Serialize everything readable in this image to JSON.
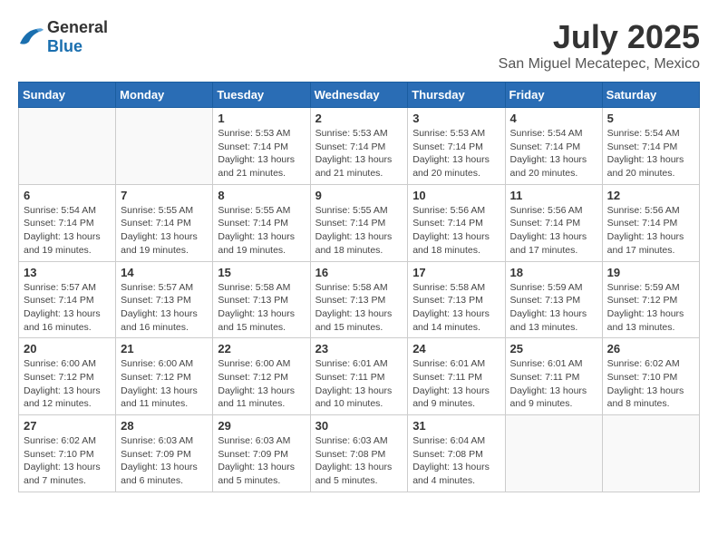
{
  "header": {
    "logo_general": "General",
    "logo_blue": "Blue",
    "month_year": "July 2025",
    "location": "San Miguel Mecatepec, Mexico"
  },
  "days_of_week": [
    "Sunday",
    "Monday",
    "Tuesday",
    "Wednesday",
    "Thursday",
    "Friday",
    "Saturday"
  ],
  "weeks": [
    [
      {
        "day": "",
        "detail": ""
      },
      {
        "day": "",
        "detail": ""
      },
      {
        "day": "1",
        "detail": "Sunrise: 5:53 AM\nSunset: 7:14 PM\nDaylight: 13 hours and 21 minutes."
      },
      {
        "day": "2",
        "detail": "Sunrise: 5:53 AM\nSunset: 7:14 PM\nDaylight: 13 hours and 21 minutes."
      },
      {
        "day": "3",
        "detail": "Sunrise: 5:53 AM\nSunset: 7:14 PM\nDaylight: 13 hours and 20 minutes."
      },
      {
        "day": "4",
        "detail": "Sunrise: 5:54 AM\nSunset: 7:14 PM\nDaylight: 13 hours and 20 minutes."
      },
      {
        "day": "5",
        "detail": "Sunrise: 5:54 AM\nSunset: 7:14 PM\nDaylight: 13 hours and 20 minutes."
      }
    ],
    [
      {
        "day": "6",
        "detail": "Sunrise: 5:54 AM\nSunset: 7:14 PM\nDaylight: 13 hours and 19 minutes."
      },
      {
        "day": "7",
        "detail": "Sunrise: 5:55 AM\nSunset: 7:14 PM\nDaylight: 13 hours and 19 minutes."
      },
      {
        "day": "8",
        "detail": "Sunrise: 5:55 AM\nSunset: 7:14 PM\nDaylight: 13 hours and 19 minutes."
      },
      {
        "day": "9",
        "detail": "Sunrise: 5:55 AM\nSunset: 7:14 PM\nDaylight: 13 hours and 18 minutes."
      },
      {
        "day": "10",
        "detail": "Sunrise: 5:56 AM\nSunset: 7:14 PM\nDaylight: 13 hours and 18 minutes."
      },
      {
        "day": "11",
        "detail": "Sunrise: 5:56 AM\nSunset: 7:14 PM\nDaylight: 13 hours and 17 minutes."
      },
      {
        "day": "12",
        "detail": "Sunrise: 5:56 AM\nSunset: 7:14 PM\nDaylight: 13 hours and 17 minutes."
      }
    ],
    [
      {
        "day": "13",
        "detail": "Sunrise: 5:57 AM\nSunset: 7:14 PM\nDaylight: 13 hours and 16 minutes."
      },
      {
        "day": "14",
        "detail": "Sunrise: 5:57 AM\nSunset: 7:13 PM\nDaylight: 13 hours and 16 minutes."
      },
      {
        "day": "15",
        "detail": "Sunrise: 5:58 AM\nSunset: 7:13 PM\nDaylight: 13 hours and 15 minutes."
      },
      {
        "day": "16",
        "detail": "Sunrise: 5:58 AM\nSunset: 7:13 PM\nDaylight: 13 hours and 15 minutes."
      },
      {
        "day": "17",
        "detail": "Sunrise: 5:58 AM\nSunset: 7:13 PM\nDaylight: 13 hours and 14 minutes."
      },
      {
        "day": "18",
        "detail": "Sunrise: 5:59 AM\nSunset: 7:13 PM\nDaylight: 13 hours and 13 minutes."
      },
      {
        "day": "19",
        "detail": "Sunrise: 5:59 AM\nSunset: 7:12 PM\nDaylight: 13 hours and 13 minutes."
      }
    ],
    [
      {
        "day": "20",
        "detail": "Sunrise: 6:00 AM\nSunset: 7:12 PM\nDaylight: 13 hours and 12 minutes."
      },
      {
        "day": "21",
        "detail": "Sunrise: 6:00 AM\nSunset: 7:12 PM\nDaylight: 13 hours and 11 minutes."
      },
      {
        "day": "22",
        "detail": "Sunrise: 6:00 AM\nSunset: 7:12 PM\nDaylight: 13 hours and 11 minutes."
      },
      {
        "day": "23",
        "detail": "Sunrise: 6:01 AM\nSunset: 7:11 PM\nDaylight: 13 hours and 10 minutes."
      },
      {
        "day": "24",
        "detail": "Sunrise: 6:01 AM\nSunset: 7:11 PM\nDaylight: 13 hours and 9 minutes."
      },
      {
        "day": "25",
        "detail": "Sunrise: 6:01 AM\nSunset: 7:11 PM\nDaylight: 13 hours and 9 minutes."
      },
      {
        "day": "26",
        "detail": "Sunrise: 6:02 AM\nSunset: 7:10 PM\nDaylight: 13 hours and 8 minutes."
      }
    ],
    [
      {
        "day": "27",
        "detail": "Sunrise: 6:02 AM\nSunset: 7:10 PM\nDaylight: 13 hours and 7 minutes."
      },
      {
        "day": "28",
        "detail": "Sunrise: 6:03 AM\nSunset: 7:09 PM\nDaylight: 13 hours and 6 minutes."
      },
      {
        "day": "29",
        "detail": "Sunrise: 6:03 AM\nSunset: 7:09 PM\nDaylight: 13 hours and 5 minutes."
      },
      {
        "day": "30",
        "detail": "Sunrise: 6:03 AM\nSunset: 7:08 PM\nDaylight: 13 hours and 5 minutes."
      },
      {
        "day": "31",
        "detail": "Sunrise: 6:04 AM\nSunset: 7:08 PM\nDaylight: 13 hours and 4 minutes."
      },
      {
        "day": "",
        "detail": ""
      },
      {
        "day": "",
        "detail": ""
      }
    ]
  ]
}
